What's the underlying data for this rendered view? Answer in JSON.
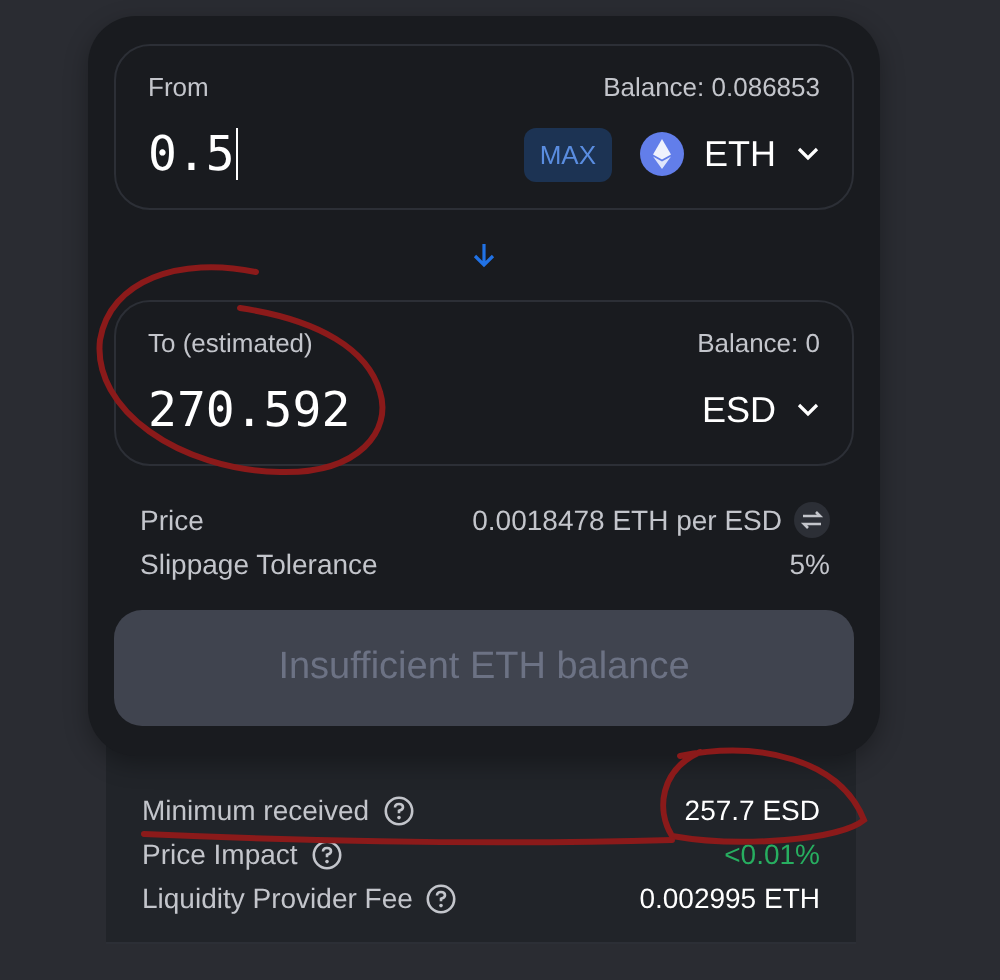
{
  "from": {
    "label": "From",
    "balance": "Balance: 0.086853",
    "amount": "0.5",
    "max_button": "MAX",
    "token": "ETH",
    "token_icon": true
  },
  "to": {
    "label": "To (estimated)",
    "balance": "Balance: 0",
    "amount": "270.592",
    "token": "ESD",
    "token_icon": false
  },
  "details": [
    {
      "label": "Price",
      "value": "0.0018478 ETH per ESD",
      "kind": "swap"
    },
    {
      "label": "Slippage Tolerance",
      "value": "5%",
      "kind": "plain"
    }
  ],
  "action_button": {
    "label": "Insufficient ETH balance",
    "disabled": true
  },
  "summary": [
    {
      "label": "Minimum received",
      "value": "257.7 ESD",
      "color": "#ffffff"
    },
    {
      "label": "Price Impact",
      "value": "<0.01%",
      "color": "#27ae60"
    },
    {
      "label": "Liquidity Provider Fee",
      "value": "0.002995 ETH",
      "color": "#ffffff"
    }
  ]
}
